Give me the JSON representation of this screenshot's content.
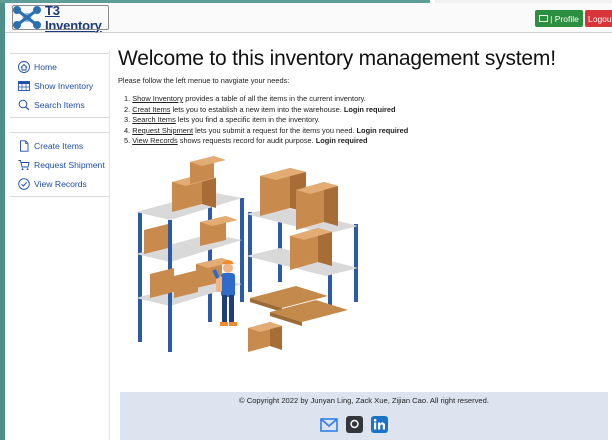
{
  "navbar": {
    "brand": "T3 Inventory",
    "profile_label": "| Profile",
    "logout_label": "Logout"
  },
  "sidebar": {
    "group1": [
      {
        "label": "Home",
        "icon": "home-icon"
      },
      {
        "label": "Show Inventory",
        "icon": "table-icon"
      },
      {
        "label": "Search Items",
        "icon": "search-icon"
      }
    ],
    "group2": [
      {
        "label": "Create Items",
        "icon": "file-icon"
      },
      {
        "label": "Request Shipment",
        "icon": "cart-icon"
      },
      {
        "label": "View Records",
        "icon": "check-circle-icon"
      }
    ]
  },
  "main": {
    "title": "Welcome to this inventory management system!",
    "subtitle": "Please follow the left menue to navgiate your needs:",
    "steps": [
      {
        "num": "1.",
        "link": "Show Inventory",
        "text": " provides a table of all the items in the current inventory.",
        "bold": ""
      },
      {
        "num": "2.",
        "link": "Creat Items",
        "text": " lets you to establish a new item into the warehouse. ",
        "bold": "Login required"
      },
      {
        "num": "3.",
        "link": "Search Items",
        "text": " lets you find a specific item in the inventory.",
        "bold": ""
      },
      {
        "num": "4.",
        "link": "Request Shipment",
        "text": " lets you submit a request for the items you need. ",
        "bold": "Login required"
      },
      {
        "num": "5.",
        "link": "View Records",
        "text": " shows requests record for audit purpose. ",
        "bold": "Login required"
      }
    ]
  },
  "footer": {
    "copyright": "© Copyright 2022 by Junyan Ling, Zack Xue, Zijian Cao. All right reserved.",
    "social": [
      "mail-icon",
      "github-icon",
      "linkedin-icon"
    ]
  },
  "colors": {
    "link": "#1e4ea6",
    "profile": "#2c8f3f",
    "logout": "#d9343a",
    "footer_bg": "#dde4ef",
    "frame": "#4f8f8a"
  }
}
